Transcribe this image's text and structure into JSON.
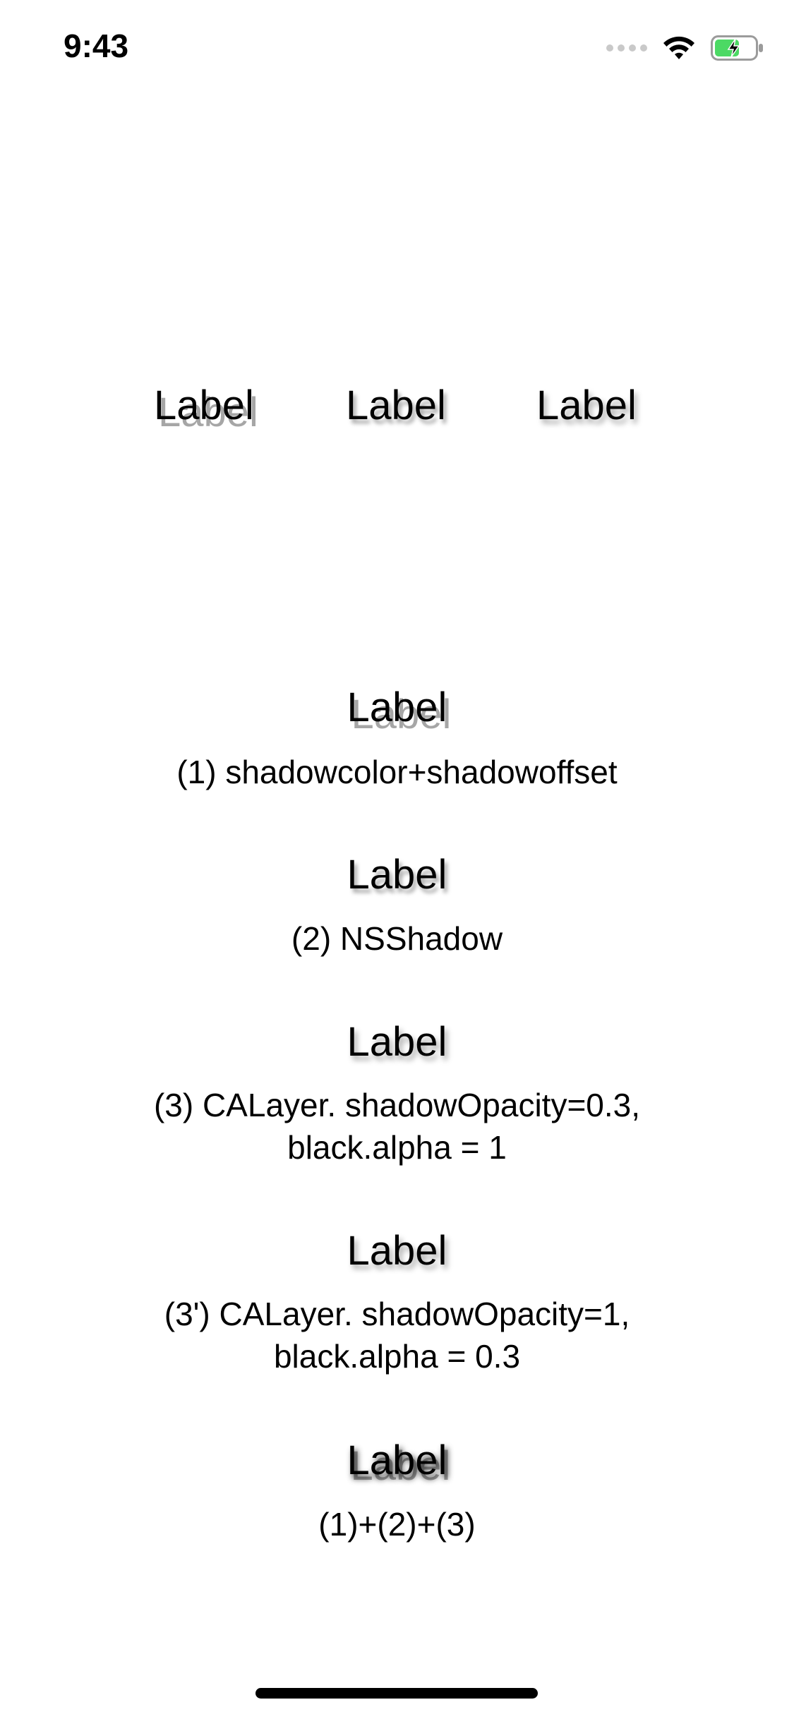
{
  "status_bar": {
    "time": "9:43"
  },
  "top_labels": [
    "Label",
    "Label",
    "Label"
  ],
  "rows": [
    {
      "label": "Label",
      "caption_lines": [
        "(1) shadowcolor+shadowoffset"
      ]
    },
    {
      "label": "Label",
      "caption_lines": [
        "(2) NSShadow"
      ]
    },
    {
      "label": "Label",
      "caption_lines": [
        "(3) CALayer. shadowOpacity=0.3,",
        "black.alpha = 1"
      ]
    },
    {
      "label": "Label",
      "caption_lines": [
        "(3') CALayer. shadowOpacity=1,",
        "black.alpha = 0.3"
      ]
    },
    {
      "label": "Label",
      "caption_lines": [
        "(1)+(2)+(3)"
      ]
    }
  ],
  "colors": {
    "battery_fill": "#4cd964",
    "signal_inactive": "#c9c9c9"
  },
  "icons": [
    "cellular-signal-icon",
    "wifi-icon",
    "battery-charging-icon"
  ]
}
